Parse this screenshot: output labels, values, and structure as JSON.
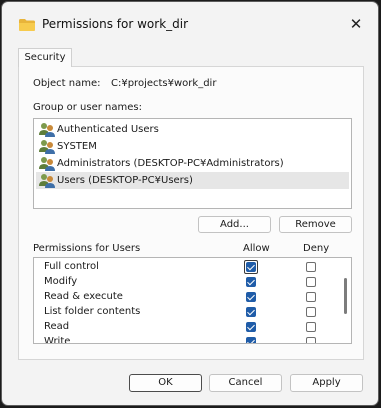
{
  "window": {
    "title": "Permissions for work_dir"
  },
  "tabs": [
    {
      "label": "Security"
    }
  ],
  "object": {
    "label": "Object name:",
    "value": "C:¥projects¥work_dir"
  },
  "group_label": "Group or user names:",
  "users": [
    {
      "name": "Authenticated Users",
      "icon": "user-group-icon"
    },
    {
      "name": "SYSTEM",
      "icon": "user-group-icon"
    },
    {
      "name": "Administrators (DESKTOP-PC¥Administrators)",
      "icon": "user-group-icon"
    },
    {
      "name": "Users (DESKTOP-PC¥Users)",
      "icon": "user-group-icon",
      "selected": true
    }
  ],
  "buttons": {
    "add": "Add...",
    "remove": "Remove",
    "ok": "OK",
    "cancel": "Cancel",
    "apply": "Apply"
  },
  "permissions": {
    "header": "Permissions for Users",
    "allow_label": "Allow",
    "deny_label": "Deny",
    "rows": [
      {
        "name": "Full control",
        "allow": true,
        "deny": false
      },
      {
        "name": "Modify",
        "allow": true,
        "deny": false
      },
      {
        "name": "Read & execute",
        "allow": true,
        "deny": false
      },
      {
        "name": "List folder contents",
        "allow": true,
        "deny": false
      },
      {
        "name": "Read",
        "allow": true,
        "deny": false
      },
      {
        "name": "Write",
        "allow": true,
        "deny": false
      }
    ]
  },
  "colors": {
    "accent": "#1f5ca8",
    "selection": "#e6e6e6"
  }
}
